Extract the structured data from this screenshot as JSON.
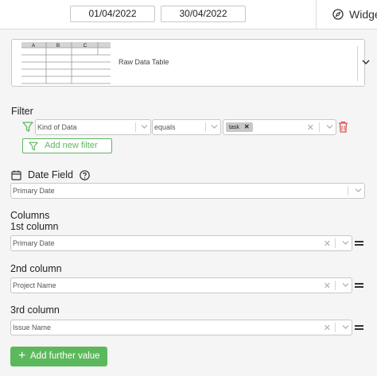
{
  "topbar": {
    "start_date": "01/04/2022",
    "end_date": "30/04/2022",
    "widget_tab_label": "Widge"
  },
  "visualization": {
    "label": "Raw Data Table",
    "thumb_columns": [
      "A",
      "B",
      "C"
    ]
  },
  "filter": {
    "section_label": "Filter",
    "field": "Kind of Data",
    "operator": "equals",
    "value_tag": "task",
    "add_button_label": "Add new filter"
  },
  "date_field": {
    "section_label": "Date Field",
    "value": "Primary Date"
  },
  "columns": {
    "section_label": "Columns",
    "items": [
      {
        "label": "1st column",
        "value": "Primary Date"
      },
      {
        "label": "2nd column",
        "value": "Project Name"
      },
      {
        "label": "3rd column",
        "value": "Issue Name"
      }
    ],
    "add_button_label": "Add further value"
  },
  "colors": {
    "accent_green": "#5cb85c",
    "delete_red": "#d9534f"
  }
}
